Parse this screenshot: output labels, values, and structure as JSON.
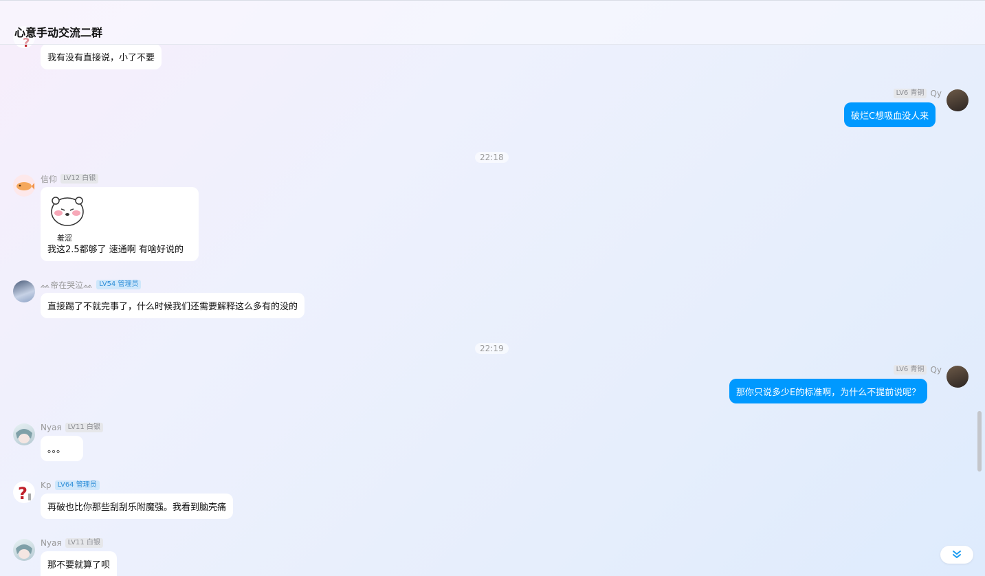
{
  "header": {
    "title": "心意手动交流二群"
  },
  "messages": {
    "top_partial": {
      "text": "我有没有直接说，小了不要"
    },
    "qy1": {
      "name": "Qy",
      "badge": "LV6 青铜",
      "text": "破烂C想吸血没人来"
    },
    "time1": "22:18",
    "xinyang": {
      "name": "信仰",
      "badge": "LV12 白银",
      "sticker_caption": "羞涩",
      "text": "我这2.5都够了 速通啊 有啥好说的"
    },
    "di": {
      "name": "ᨐ帝在哭泣ᨐ",
      "badge": "LV54 管理员",
      "text": "直接踢了不就完事了，什么时候我们还需要解释这么多有的没的"
    },
    "time2": "22:19",
    "qy2": {
      "name": "Qy",
      "badge": "LV6 青铜",
      "text": "那你只说多少E的标准啊，为什么不提前说呢？"
    },
    "nyaa1": {
      "name": "Nyaя",
      "badge": "LV11 白银",
      "text": "。。。"
    },
    "kp": {
      "name": "Kp",
      "badge": "LV64 管理员",
      "text": "再破也比你那些刮刮乐附魔强。我看到脑壳痛"
    },
    "nyaa2": {
      "name": "Nyaя",
      "badge": "LV11 白银",
      "text": "那不要就算了呗"
    }
  },
  "colors": {
    "my_bubble": "#0099ff",
    "other_bubble": "#ffffff",
    "admin_badge": "#cfe7fb"
  }
}
